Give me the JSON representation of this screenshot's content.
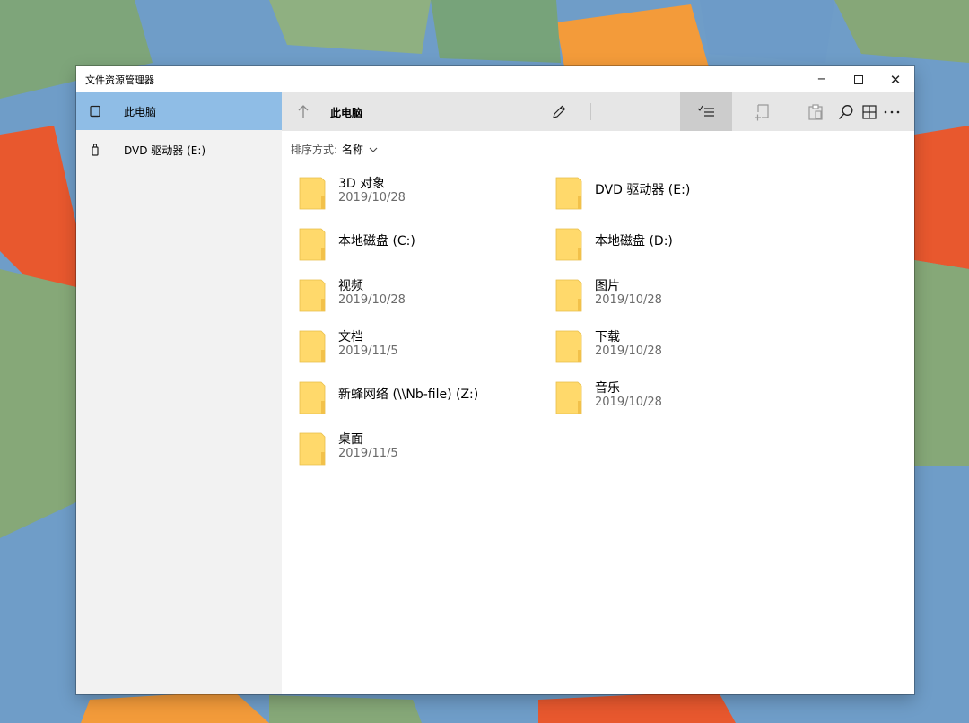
{
  "window": {
    "title": "文件资源管理器",
    "controls": {
      "minimize": "−",
      "maximize": "☐",
      "close": "✕"
    }
  },
  "sidebar": {
    "items": [
      {
        "label": "此电脑",
        "icon": "computer-icon",
        "selected": true
      },
      {
        "label": "DVD 驱动器 (E:)",
        "icon": "usb-drive-icon",
        "selected": false
      }
    ]
  },
  "toolbar": {
    "location": "此电脑",
    "up_icon": "arrow-up-icon",
    "buttons": [
      "rename-icon",
      "select-list-icon",
      "new-folder-icon",
      "paste-icon",
      "grid-view-icon",
      "search-icon",
      "more-icon"
    ],
    "active_button": "select-list-icon"
  },
  "sort": {
    "label": "排序方式:",
    "value": "名称"
  },
  "files": {
    "left": [
      {
        "name": "3D 对象",
        "date": "2019/10/28"
      },
      {
        "name": "本地磁盘 (C:)",
        "date": ""
      },
      {
        "name": "视频",
        "date": "2019/10/28"
      },
      {
        "name": "文档",
        "date": "2019/11/5"
      },
      {
        "name": "新蜂网络 (\\\\Nb-file) (Z:)",
        "date": ""
      },
      {
        "name": "桌面",
        "date": "2019/11/5"
      }
    ],
    "right": [
      {
        "name": "DVD 驱动器 (E:)",
        "date": ""
      },
      {
        "name": "本地磁盘 (D:)",
        "date": ""
      },
      {
        "name": "图片",
        "date": "2019/10/28"
      },
      {
        "name": "下载",
        "date": "2019/10/28"
      },
      {
        "name": "音乐",
        "date": "2019/10/28"
      }
    ]
  },
  "colors": {
    "selected_nav": "#8fbde6",
    "sidebar_bg": "#f2f2f2",
    "toolbar_bg": "#e6e6e6",
    "folder": "#ffd96b"
  }
}
